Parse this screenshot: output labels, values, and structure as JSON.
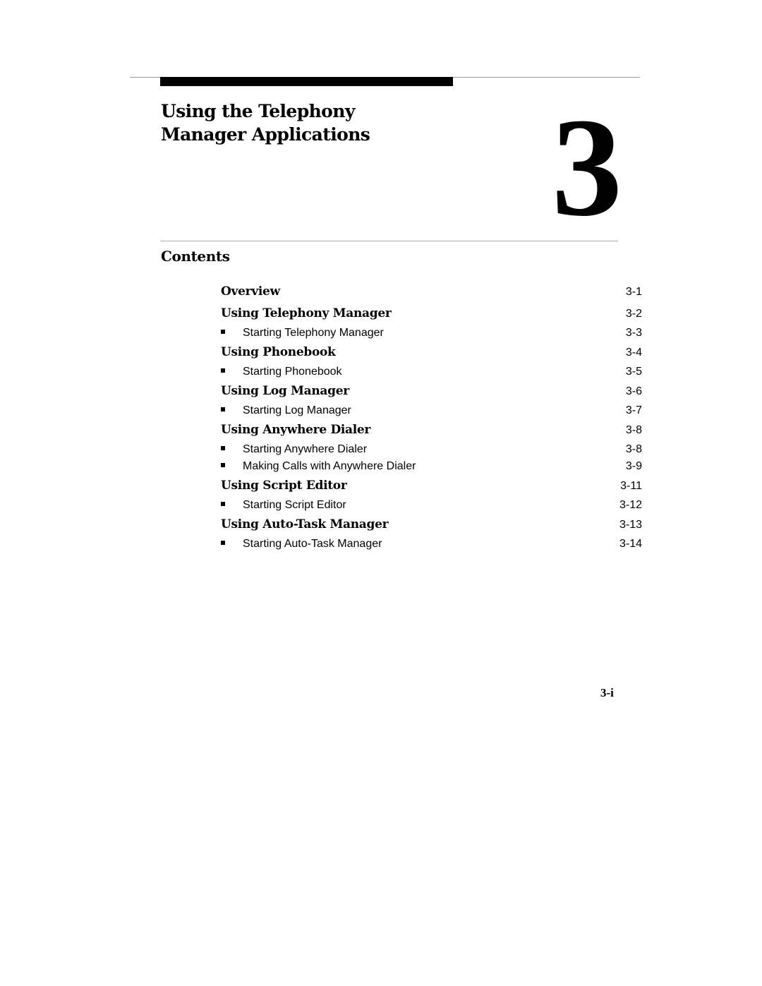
{
  "chapter": {
    "title_line1": "Using the Telephony",
    "title_line2": "Manager Applications",
    "number": "3"
  },
  "contents": {
    "heading": "Contents",
    "entries": [
      {
        "level": 1,
        "label": "Overview",
        "page": "3-1"
      },
      {
        "level": 1,
        "label": "Using Telephony Manager",
        "page": "3-2"
      },
      {
        "level": 2,
        "label": "Starting Telephony Manager",
        "page": "3-3"
      },
      {
        "level": 1,
        "label": "Using Phonebook",
        "page": "3-4"
      },
      {
        "level": 2,
        "label": "Starting Phonebook",
        "page": "3-5"
      },
      {
        "level": 1,
        "label": "Using Log Manager",
        "page": "3-6"
      },
      {
        "level": 2,
        "label": "Starting Log Manager",
        "page": "3-7"
      },
      {
        "level": 1,
        "label": "Using Anywhere Dialer",
        "page": "3-8"
      },
      {
        "level": 2,
        "label": "Starting Anywhere Dialer",
        "page": "3-8"
      },
      {
        "level": 2,
        "label": "Making Calls with Anywhere Dialer",
        "page": "3-9"
      },
      {
        "level": 1,
        "label": "Using Script Editor",
        "page": "3-11"
      },
      {
        "level": 2,
        "label": "Starting Script Editor",
        "page": "3-12"
      },
      {
        "level": 1,
        "label": "Using Auto-Task Manager",
        "page": "3-13"
      },
      {
        "level": 2,
        "label": "Starting Auto-Task Manager",
        "page": "3-14"
      }
    ]
  },
  "footer": {
    "page_number": "3-i"
  }
}
